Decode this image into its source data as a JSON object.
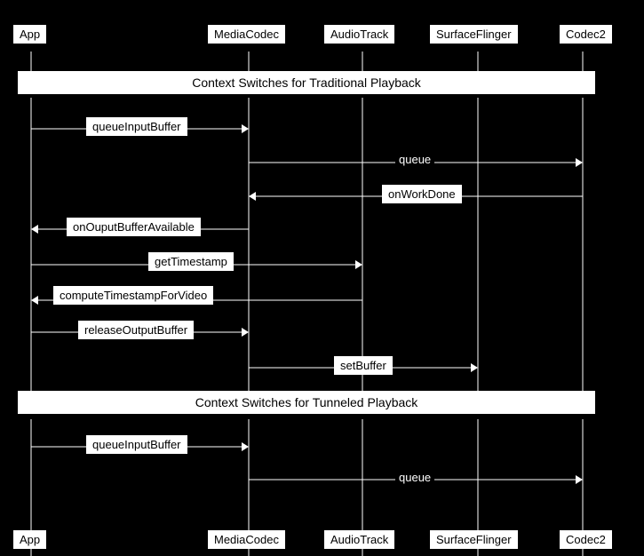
{
  "header_row": {
    "app": "App",
    "mediacodec": "MediaCodec",
    "audiotrack": "AudioTrack",
    "surfaceflinger": "SurfaceFlinger",
    "codec2": "Codec2"
  },
  "footer_row": {
    "app": "App",
    "mediacodec": "MediaCodec",
    "audiotrack": "AudioTrack",
    "surfaceflinger": "SurfaceFlinger",
    "codec2": "Codec2"
  },
  "section1": {
    "title": "Context Switches for Traditional Playback"
  },
  "section2": {
    "title": "Context Switches for Tunneled Playback"
  },
  "labels_section1": {
    "queueInputBuffer": "queueInputBuffer",
    "queue": "queue",
    "onWorkDone": "onWorkDone",
    "onOuputBufferAvailable": "onOuputBufferAvailable",
    "getTimestamp": "getTimestamp",
    "computeTimestampForVideo": "computeTimestampForVideo",
    "releaseOutputBuffer": "releaseOutputBuffer",
    "setBuffer": "setBuffer"
  },
  "labels_section2": {
    "queueInputBuffer": "queueInputBuffer",
    "queue": "queue"
  }
}
